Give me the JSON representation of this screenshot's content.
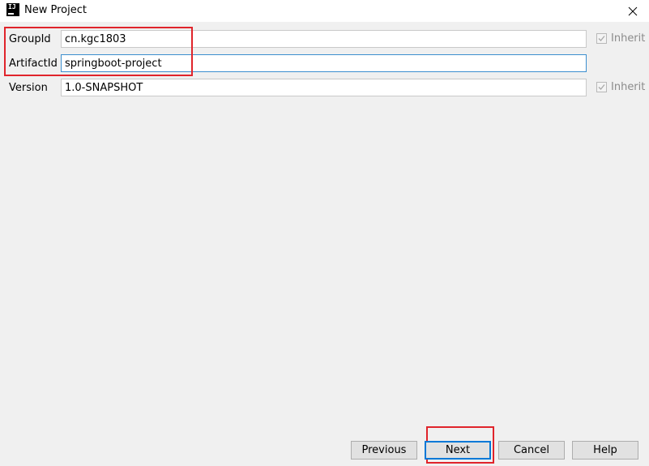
{
  "window": {
    "title": "New Project",
    "icon_name": "intellij-idea-icon",
    "icon_text": "IJ"
  },
  "form": {
    "group_id": {
      "label": "GroupId",
      "value": "cn.kgc1803",
      "inherit_label": "Inherit",
      "inherit_checked": true
    },
    "artifact_id": {
      "label": "ArtifactId",
      "value": "springboot-project"
    },
    "version": {
      "label": "Version",
      "value": "1.0-SNAPSHOT",
      "inherit_label": "Inherit",
      "inherit_checked": true
    }
  },
  "buttons": {
    "previous": "Previous",
    "next": "Next",
    "cancel": "Cancel",
    "help": "Help"
  },
  "colors": {
    "annotation": "#e0242b",
    "focus": "#3c8fcf",
    "default_button_border": "#0078d7",
    "background": "#f0f0f0"
  }
}
